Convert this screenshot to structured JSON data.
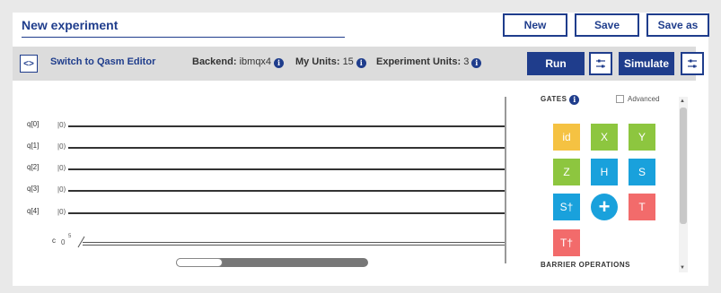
{
  "header": {
    "title": "New experiment",
    "new_label": "New",
    "save_label": "Save",
    "save_as_label": "Save as"
  },
  "toolbar": {
    "editor_toggle_icon": "<>",
    "switch_label": "Switch to Qasm Editor",
    "backend_label": "Backend:",
    "backend_value": "ibmqx4",
    "my_units_label": "My Units:",
    "my_units_value": "15",
    "experiment_units_label": "Experiment Units:",
    "experiment_units_value": "3",
    "run_label": "Run",
    "simulate_label": "Simulate"
  },
  "circuit": {
    "qubits": [
      {
        "label": "q[0]",
        "ket": "|0⟩"
      },
      {
        "label": "q[1]",
        "ket": "|0⟩"
      },
      {
        "label": "q[2]",
        "ket": "|0⟩"
      },
      {
        "label": "q[3]",
        "ket": "|0⟩"
      },
      {
        "label": "q[4]",
        "ket": "|0⟩"
      }
    ],
    "classical": {
      "label": "c",
      "value": "0",
      "bits": "5"
    }
  },
  "gates_panel": {
    "title": "GATES",
    "advanced_label": "Advanced",
    "gates": [
      {
        "label": "id",
        "color": "#f5c242"
      },
      {
        "label": "X",
        "color": "#8dc63f"
      },
      {
        "label": "Y",
        "color": "#8dc63f"
      },
      {
        "label": "Z",
        "color": "#8dc63f"
      },
      {
        "label": "H",
        "color": "#19a1dc"
      },
      {
        "label": "S",
        "color": "#19a1dc"
      },
      {
        "label": "S†",
        "color": "#19a1dc"
      },
      {
        "label": "T",
        "color": "#f26b6b"
      },
      {
        "label": "T†",
        "color": "#f26b6b"
      }
    ],
    "add_symbol": "+",
    "barrier_label": "BARRIER OPERATIONS"
  },
  "colors": {
    "accent": "#1f3d8c",
    "toolbar_bg": "#dcdcdc"
  }
}
